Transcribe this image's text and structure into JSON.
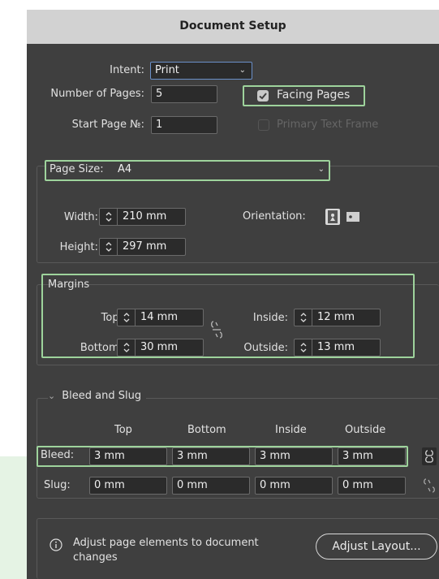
{
  "title": "Document Setup",
  "general": {
    "intent_label": "Intent:",
    "intent_value": "Print",
    "pages_label": "Number of Pages:",
    "pages_value": "5",
    "facing_label": "Facing Pages",
    "facing_checked": true,
    "start_label": "Start Page №:",
    "start_value": "1",
    "primary_label": "Primary Text Frame",
    "primary_checked": false
  },
  "page_size": {
    "label": "Page Size:",
    "value": "A4",
    "width_label": "Width:",
    "width_value": "210 mm",
    "height_label": "Height:",
    "height_value": "297 mm",
    "orientation_label": "Orientation:",
    "orientation_selected": "portrait"
  },
  "margins": {
    "title": "Margins",
    "top_label": "Top:",
    "top_value": "14 mm",
    "bottom_label": "Bottom:",
    "bottom_value": "30 mm",
    "inside_label": "Inside:",
    "inside_value": "12 mm",
    "outside_label": "Outside:",
    "outside_value": "13 mm"
  },
  "bleed_slug": {
    "title": "Bleed and Slug",
    "columns": [
      "Top",
      "Bottom",
      "Inside",
      "Outside"
    ],
    "bleed_label": "Bleed:",
    "bleed_values": [
      "3 mm",
      "3 mm",
      "3 mm",
      "3 mm"
    ],
    "slug_label": "Slug:",
    "slug_values": [
      "0 mm",
      "0 mm",
      "0 mm",
      "0 mm"
    ]
  },
  "footer": {
    "info_line1": "Adjust page elements to document",
    "info_line2": "changes",
    "adjust_button": "Adjust Layout..."
  },
  "colors": {
    "dialog_bg": "#3f3f3f",
    "titlebar_bg": "#d2d2d2",
    "highlight": "#9ed39c",
    "field_bg": "#2b2b2b"
  }
}
